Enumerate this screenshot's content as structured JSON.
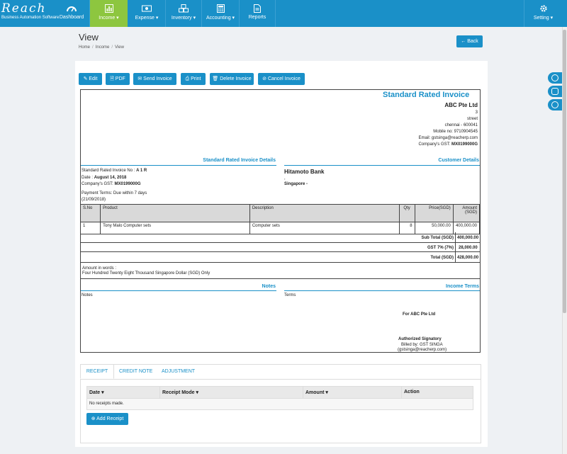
{
  "brand": {
    "name": "Reach",
    "tagline": "Business Automation Software"
  },
  "nav": {
    "items": [
      {
        "label": "Dashboard",
        "icon": "dashboard-icon"
      },
      {
        "label": "Income ▾",
        "icon": "bar-chart-icon",
        "active": true
      },
      {
        "label": "Expense ▾",
        "icon": "money-icon"
      },
      {
        "label": "Inventory ▾",
        "icon": "cubes-icon"
      },
      {
        "label": "Accounting ▾",
        "icon": "calculator-icon"
      },
      {
        "label": "Reports",
        "icon": "file-icon"
      }
    ],
    "setting": "Setting ▾"
  },
  "page": {
    "title": "View",
    "breadcrumb": [
      "Home",
      "Income",
      "View"
    ],
    "back": "Back"
  },
  "toolbar": {
    "edit": "Edit",
    "pdf": "PDF",
    "send": "Send Invoice",
    "print": "Print",
    "delete": "Delete Invoice",
    "cancel": "Cancel Invoice"
  },
  "invoice": {
    "doc_title": "Standard Rated Invoice",
    "company": {
      "name": "ABC Pte Ltd",
      "line1": "3",
      "line2": "street",
      "city": "chennai - 600041",
      "mobile": "Mobile no: 9710904545",
      "email": "Email: gstsinga@reacherp.com",
      "gst_label": "Company's GST:",
      "gst": "MX0199000G"
    },
    "details_head": "Standard Rated Invoice Details",
    "customer_head": "Customer Details",
    "details": {
      "no_label": "Standard Rated Invoice No :",
      "no": "A 1 R",
      "date_label": "Date :",
      "date": "August 14, 2018",
      "gst_label": "Company's GST:",
      "gst": "MX0199000G",
      "terms": "Payment Terms: Due within 7 days",
      "terms_date": "(21/09/2018)"
    },
    "customer": {
      "name": "Hitamoto Bank",
      "line1": ",",
      "line2": "Singapore -"
    },
    "table": {
      "headers": [
        "S.No",
        "Product",
        "Description",
        "Qty",
        "Price(SGD)",
        "Amount (SGD)"
      ],
      "rows": [
        [
          "1",
          "Tony Malo Computer sets",
          "Computer sets",
          "8",
          "50,000.00",
          "400,000.00"
        ]
      ]
    },
    "totals": {
      "sub_label": "Sub Total (SGD)",
      "sub": "400,000.00",
      "gst_label": "GST 7% (7%)",
      "gst": "28,000.00",
      "total_label": "Total (SGD)",
      "total": "428,000.00"
    },
    "words_label": "Amount in words :",
    "words": "Four Hundred Twenty Eight Thousand Singapore Dollar (SGD) Only",
    "notes_head": "Notes",
    "terms_head": "Income Terms",
    "notes_label": "Notes",
    "terms_label": "Terms",
    "for_company": "For ABC Pte Ltd",
    "signatory": "Authorized Signatory",
    "billed_by": "Billed by: GST SINGA",
    "billed_email": "(gstsinga@reacherp.com)"
  },
  "tabs": [
    "RECEIPT",
    "CREDIT NOTE",
    "ADJUSTMENT"
  ],
  "receipts": {
    "headers": [
      "Date ▾",
      "Receipt Mode ▾",
      "Amount ▾",
      "Action"
    ],
    "empty": "No receipts made.",
    "add": "Add Receipt"
  },
  "colors": {
    "primary": "#1a90c8",
    "active_nav": "#8dc63f"
  }
}
